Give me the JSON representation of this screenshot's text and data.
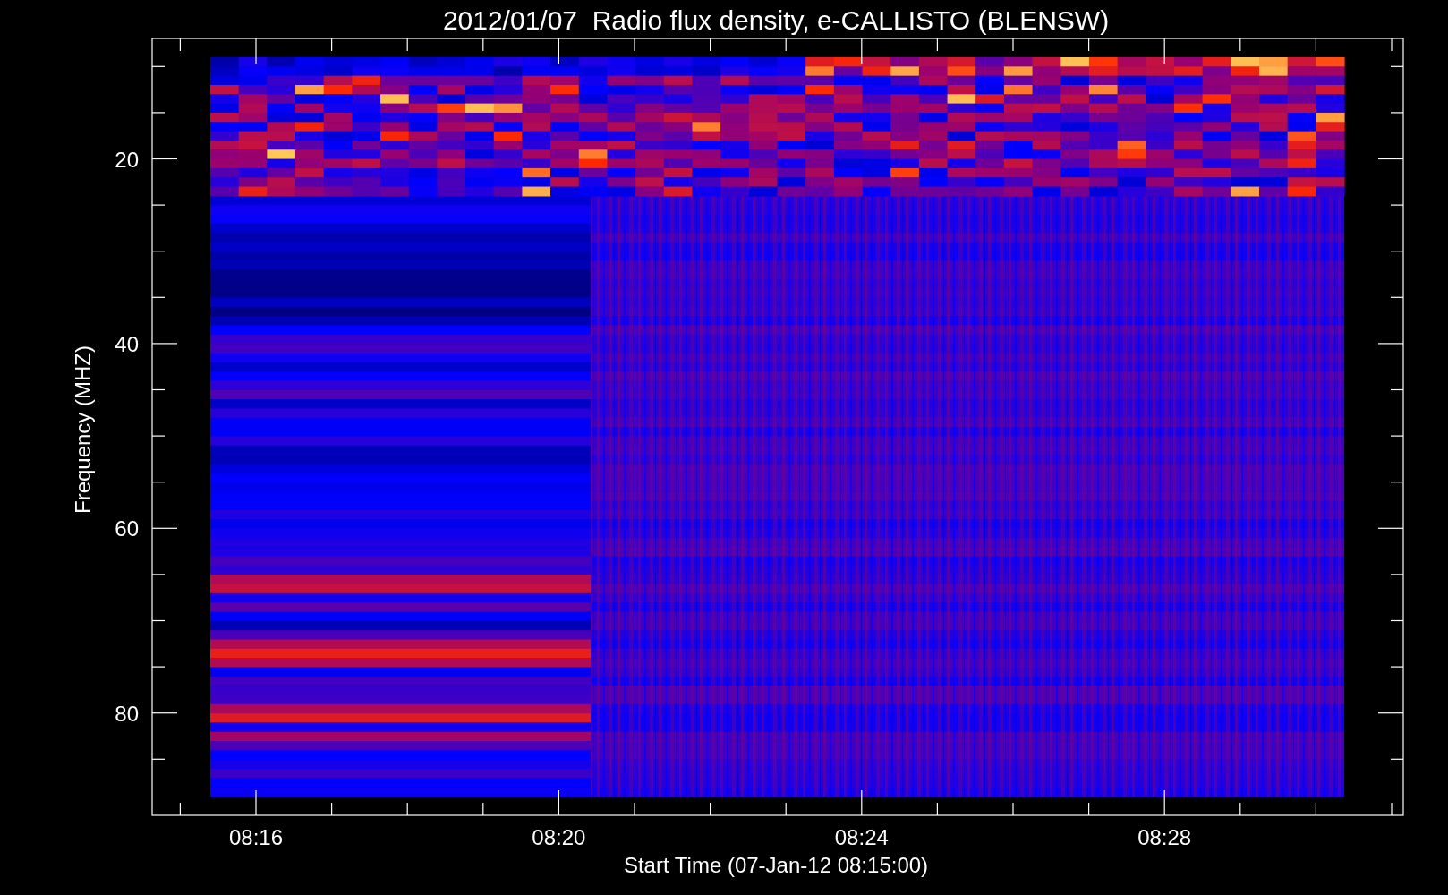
{
  "plot": {
    "title": "2012/01/07  Radio flux density, e-CALLISTO (BLENSW)",
    "ylabel": "Frequency (MHZ)",
    "xlabel": "Start Time (07-Jan-12 08:15:00)",
    "yticks": [
      "20",
      "40",
      "60",
      "80"
    ],
    "xticks": [
      "08:16",
      "08:20",
      "08:24",
      "08:28"
    ]
  }
}
